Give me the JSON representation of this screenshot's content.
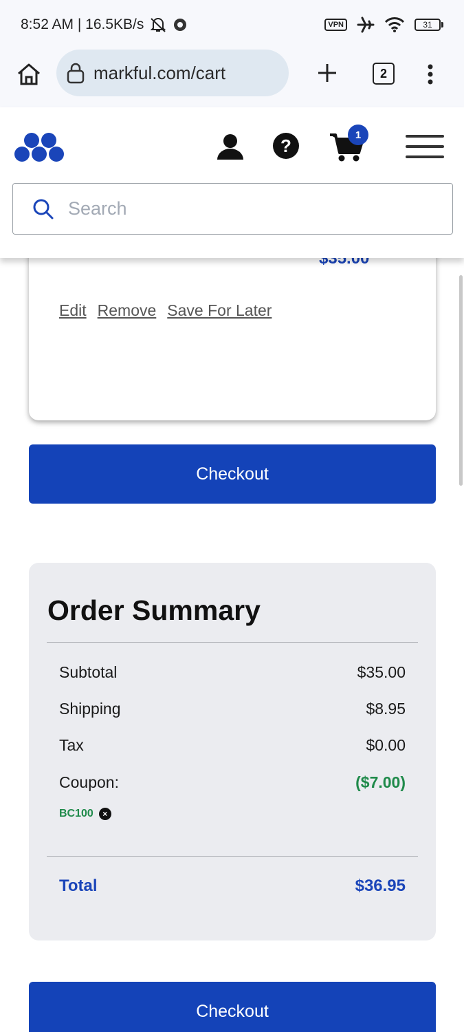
{
  "status_bar": {
    "time": "8:52 AM | 16.5KB/s",
    "vpn": "VPN",
    "battery": "31"
  },
  "browser": {
    "url": "markful.com/cart",
    "tab_count": "2"
  },
  "header": {
    "cart_count": "1",
    "search_placeholder": "Search"
  },
  "cart_item": {
    "price": "$35.00",
    "actions": [
      "Edit",
      "Remove",
      "Save For Later"
    ]
  },
  "checkout_label": "Checkout",
  "order_summary": {
    "title": "Order Summary",
    "subtotal_label": "Subtotal",
    "subtotal_value": "$35.00",
    "shipping_label": "Shipping",
    "shipping_value": "$8.95",
    "tax_label": "Tax",
    "tax_value": "$0.00",
    "coupon_label": "Coupon:",
    "coupon_value": "($7.00)",
    "coupon_code": "BC100",
    "total_label": "Total",
    "total_value": "$36.95"
  },
  "colors": {
    "brand_blue": "#1443b8",
    "coupon_green": "#1f8a4a",
    "summary_bg": "#ebecf0"
  }
}
